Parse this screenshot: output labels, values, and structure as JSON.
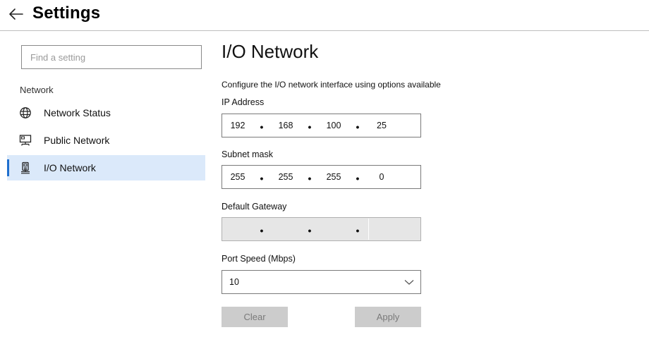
{
  "header": {
    "title": "Settings",
    "back_icon": "arrow-left-icon"
  },
  "sidebar": {
    "search_placeholder": "Find a setting",
    "section_label": "Network",
    "items": [
      {
        "label": "Network Status",
        "icon": "globe-icon"
      },
      {
        "label": "Public Network",
        "icon": "monitor-network-icon"
      },
      {
        "label": "I/O Network",
        "icon": "device-port-icon",
        "selected": true
      }
    ]
  },
  "main": {
    "title": "I/O Network",
    "description": "Configure the I/O network interface using options available",
    "ip_address": {
      "label": "IP Address",
      "octets": [
        "192",
        "168",
        "100",
        "25"
      ]
    },
    "subnet_mask": {
      "label": "Subnet mask",
      "octets": [
        "255",
        "255",
        "255",
        "0"
      ]
    },
    "default_gateway": {
      "label": "Default Gateway",
      "octets": [
        "",
        "",
        "",
        ""
      ],
      "disabled": true
    },
    "port_speed": {
      "label": "Port Speed (Mbps)",
      "selected": "10"
    },
    "buttons": {
      "clear": "Clear",
      "apply": "Apply"
    }
  },
  "colors": {
    "accent": "#1f6fce",
    "selected_bg": "#dbe9fa",
    "disabled_btn": "#cccccc"
  }
}
